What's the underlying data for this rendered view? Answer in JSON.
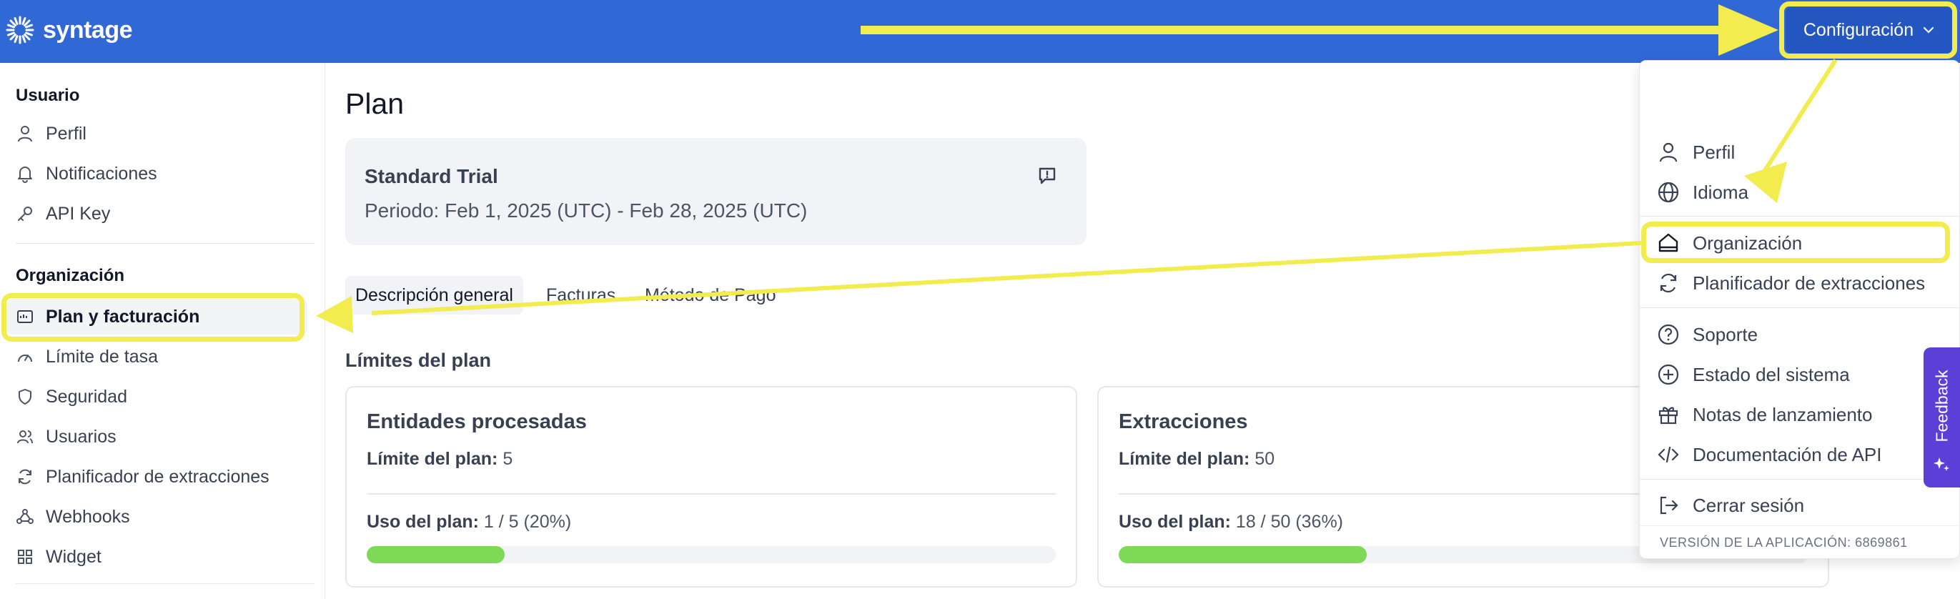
{
  "app": {
    "name": "syntage"
  },
  "header": {
    "config_label": "Configuración"
  },
  "sidebar": {
    "user_section": "Usuario",
    "user_items": [
      "Perfil",
      "Notificaciones",
      "API Key"
    ],
    "org_section": "Organización",
    "org_items": [
      "Plan y facturación",
      "Límite de tasa",
      "Seguridad",
      "Usuarios",
      "Planificador de extracciones",
      "Webhooks",
      "Widget"
    ]
  },
  "main": {
    "title": "Plan",
    "plan": {
      "name": "Standard Trial",
      "period": "Periodo: Feb 1, 2025 (UTC) - Feb 28, 2025 (UTC)"
    },
    "tabs": [
      "Descripción general",
      "Facturas",
      "Método de Pago"
    ],
    "limits_title": "Límites del plan",
    "limit_label": "Límite del plan:",
    "usage_label": "Uso del plan:",
    "limits": [
      {
        "title": "Entidades procesadas",
        "limit": "5",
        "usage": "1 / 5 (20%)",
        "fraction": 0.2
      },
      {
        "title": "Extracciones",
        "limit": "50",
        "usage": "18 / 50 (36%)",
        "fraction": 0.36
      }
    ]
  },
  "dropdown": {
    "items": [
      "Perfil",
      "Idioma",
      "Organización",
      "Planificador de extracciones",
      "Soporte",
      "Estado del sistema",
      "Notas de lanzamiento",
      "Documentación de API",
      "Cerrar sesión"
    ],
    "version": "VERSIÓN DE LA APLICACIÓN: 6869861"
  },
  "feedback": {
    "label": "Feedback"
  },
  "colors": {
    "topbar": "#3068d6",
    "highlight": "#f3ec4e",
    "progress": "#7ed957",
    "feedback": "#5b3fd6"
  }
}
